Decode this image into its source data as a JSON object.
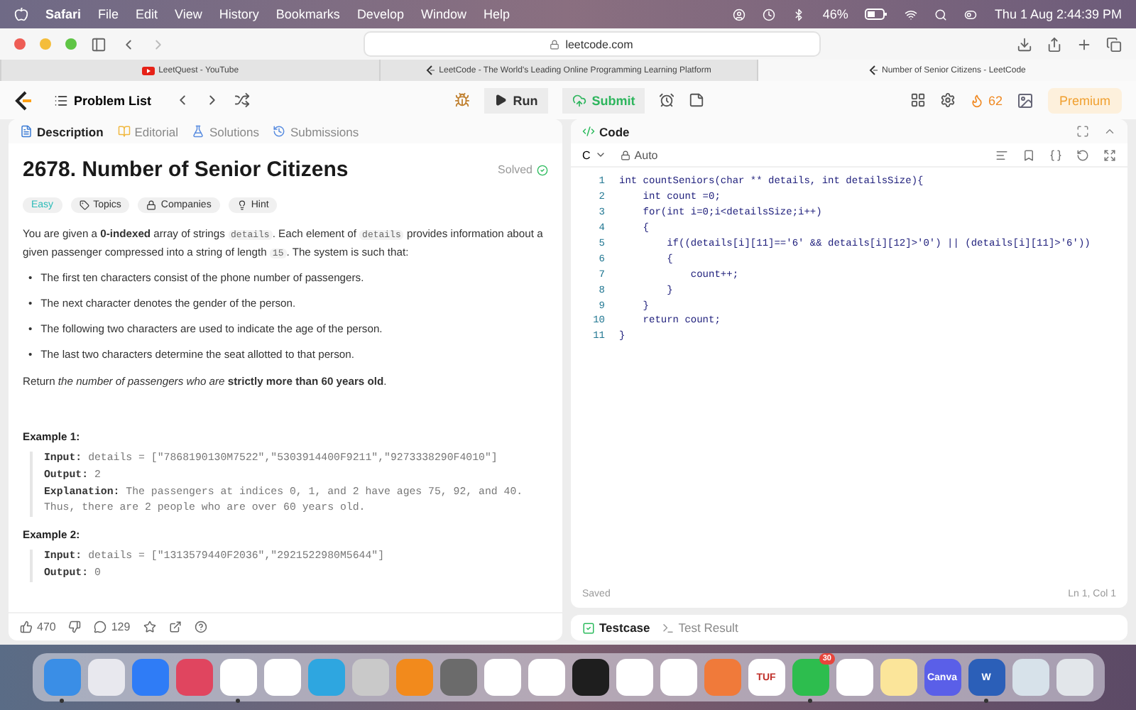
{
  "menu_bar": {
    "app": "Safari",
    "items": [
      "File",
      "Edit",
      "View",
      "History",
      "Bookmarks",
      "Develop",
      "Window",
      "Help"
    ],
    "battery": "46%",
    "clock": "Thu 1 Aug  2:44:39 PM"
  },
  "browser": {
    "url": "leetcode.com",
    "tabs": [
      {
        "title": "LeetQuest - YouTube",
        "kind": "youtube",
        "selected": false
      },
      {
        "title": "LeetCode - The World's Leading Online Programming Learning Platform",
        "kind": "leetcode",
        "selected": false
      },
      {
        "title": "Number of Senior Citizens - LeetCode",
        "kind": "leetcode",
        "selected": true
      }
    ]
  },
  "nav": {
    "problem_list": "Problem List",
    "run": "Run",
    "submit": "Submit",
    "streak": "62",
    "premium": "Premium"
  },
  "description_panel": {
    "tabs": [
      {
        "label": "Description",
        "kind": "doc",
        "selected": true
      },
      {
        "label": "Editorial",
        "kind": "book",
        "selected": false
      },
      {
        "label": "Solutions",
        "kind": "flask",
        "selected": false
      },
      {
        "label": "Submissions",
        "kind": "history",
        "selected": false
      }
    ],
    "title": "2678. Number of Senior Citizens",
    "status": "Solved",
    "tags": [
      {
        "label": "Easy",
        "kind": "difficulty"
      },
      {
        "label": "Topics",
        "kind": "tag"
      },
      {
        "label": "Companies",
        "kind": "lock"
      },
      {
        "label": "Hint",
        "kind": "bulb"
      }
    ],
    "paragraph": [
      {
        "kind": "text",
        "text": "You are given a **0-indexed** array of strings "
      },
      {
        "kind": "code",
        "text": "details"
      },
      {
        "kind": "text",
        "text": ". Each element of "
      },
      {
        "kind": "code",
        "text": "details"
      },
      {
        "kind": "text",
        "text": " provides information about a given passenger compressed into a string of length "
      },
      {
        "kind": "code",
        "text": "15"
      },
      {
        "kind": "text",
        "text": ". The system is such that:"
      }
    ],
    "bullets": [
      {
        "marker": "•",
        "text": "The first ten characters consist of the phone number of passengers."
      },
      {
        "marker": "•",
        "text": "The next character denotes the gender of the person."
      },
      {
        "marker": "•",
        "text": "The following two characters are used to indicate the age of the person."
      },
      {
        "marker": "•",
        "text": "The last two characters determine the seat allotted to that person."
      }
    ],
    "return_text": "Return *the number of passengers who are* **strictly more than 60 years old**.",
    "examples": [
      {
        "title": "Example 1:",
        "lines": [
          {
            "label": "Input:",
            "value": "details = [\"7868190130M7522\",\"5303914400F9211\",\"9273338290F4010\"]"
          },
          {
            "label": "Output:",
            "value": "2"
          },
          {
            "label": "Explanation:",
            "value": "The passengers at indices 0, 1, and 2 have ages 75, 92, and 40. Thus, there are 2 people who are over 60 years old."
          }
        ]
      },
      {
        "title": "Example 2:",
        "lines": [
          {
            "label": "Input:",
            "value": "details = [\"1313579440F2036\",\"2921522980M5644\"]"
          },
          {
            "label": "Output:",
            "value": "0"
          }
        ]
      }
    ],
    "footer": {
      "likes": "470",
      "comments": "129"
    }
  },
  "code_panel": {
    "title": "Code",
    "language": "C",
    "mode": "Auto",
    "lines": [
      {
        "number": "1",
        "text": "int countSeniors(char ** details, int detailsSize){"
      },
      {
        "number": "2",
        "text": "    int count =0;"
      },
      {
        "number": "3",
        "text": "    for(int i=0;i<detailsSize;i++)"
      },
      {
        "number": "4",
        "text": "    {"
      },
      {
        "number": "5",
        "text": "        if((details[i][11]=='6' && details[i][12]>'0') || (details[i][11]>'6'))"
      },
      {
        "number": "6",
        "text": "        {"
      },
      {
        "number": "7",
        "text": "            count++;"
      },
      {
        "number": "8",
        "text": "        }"
      },
      {
        "number": "9",
        "text": "    }"
      },
      {
        "number": "10",
        "text": "    return count;"
      },
      {
        "number": "11",
        "text": "}"
      }
    ],
    "saved": "Saved",
    "cursor": "Ln 1, Col 1"
  },
  "test_panel": {
    "tabs": [
      {
        "label": "Testcase",
        "selected": true
      },
      {
        "label": "Test Result",
        "selected": false
      }
    ]
  },
  "dock": [
    {
      "color": "#3a8ee6",
      "running": true
    },
    {
      "color": "#e8e8ee",
      "running": false
    },
    {
      "color": "#2f7cf6",
      "running": false
    },
    {
      "color": "#e0455f",
      "running": false
    },
    {
      "color": "#ffffff",
      "running": true
    },
    {
      "color": "#ffffff",
      "running": false
    },
    {
      "color": "#2ea6e0",
      "running": false
    },
    {
      "color": "#c9c9c9",
      "running": false
    },
    {
      "color": "#f28a1c",
      "running": false
    },
    {
      "color": "#6b6b6b",
      "running": false
    },
    {
      "color": "#ffffff",
      "running": false
    },
    {
      "color": "#ffffff",
      "running": false
    },
    {
      "color": "#1e1e1e",
      "running": false
    },
    {
      "color": "#ffffff",
      "running": false
    },
    {
      "color": "#ffffff",
      "running": false
    },
    {
      "color": "#f07a3a",
      "running": false
    },
    {
      "color": "#ffffff",
      "label": "TUF",
      "running": false
    },
    {
      "color": "#2dbd4e",
      "badge": "30",
      "running": true
    },
    {
      "color": "#ffffff",
      "running": false
    },
    {
      "color": "#fbe59a",
      "running": false
    },
    {
      "color": "#5a5fe8",
      "label": "Canva",
      "running": false
    },
    {
      "color": "#2b5fb8",
      "label": "W",
      "running": true
    },
    {
      "color": "#d7e2ea",
      "running": false
    },
    {
      "color": "#e2e6ea",
      "running": false
    }
  ]
}
